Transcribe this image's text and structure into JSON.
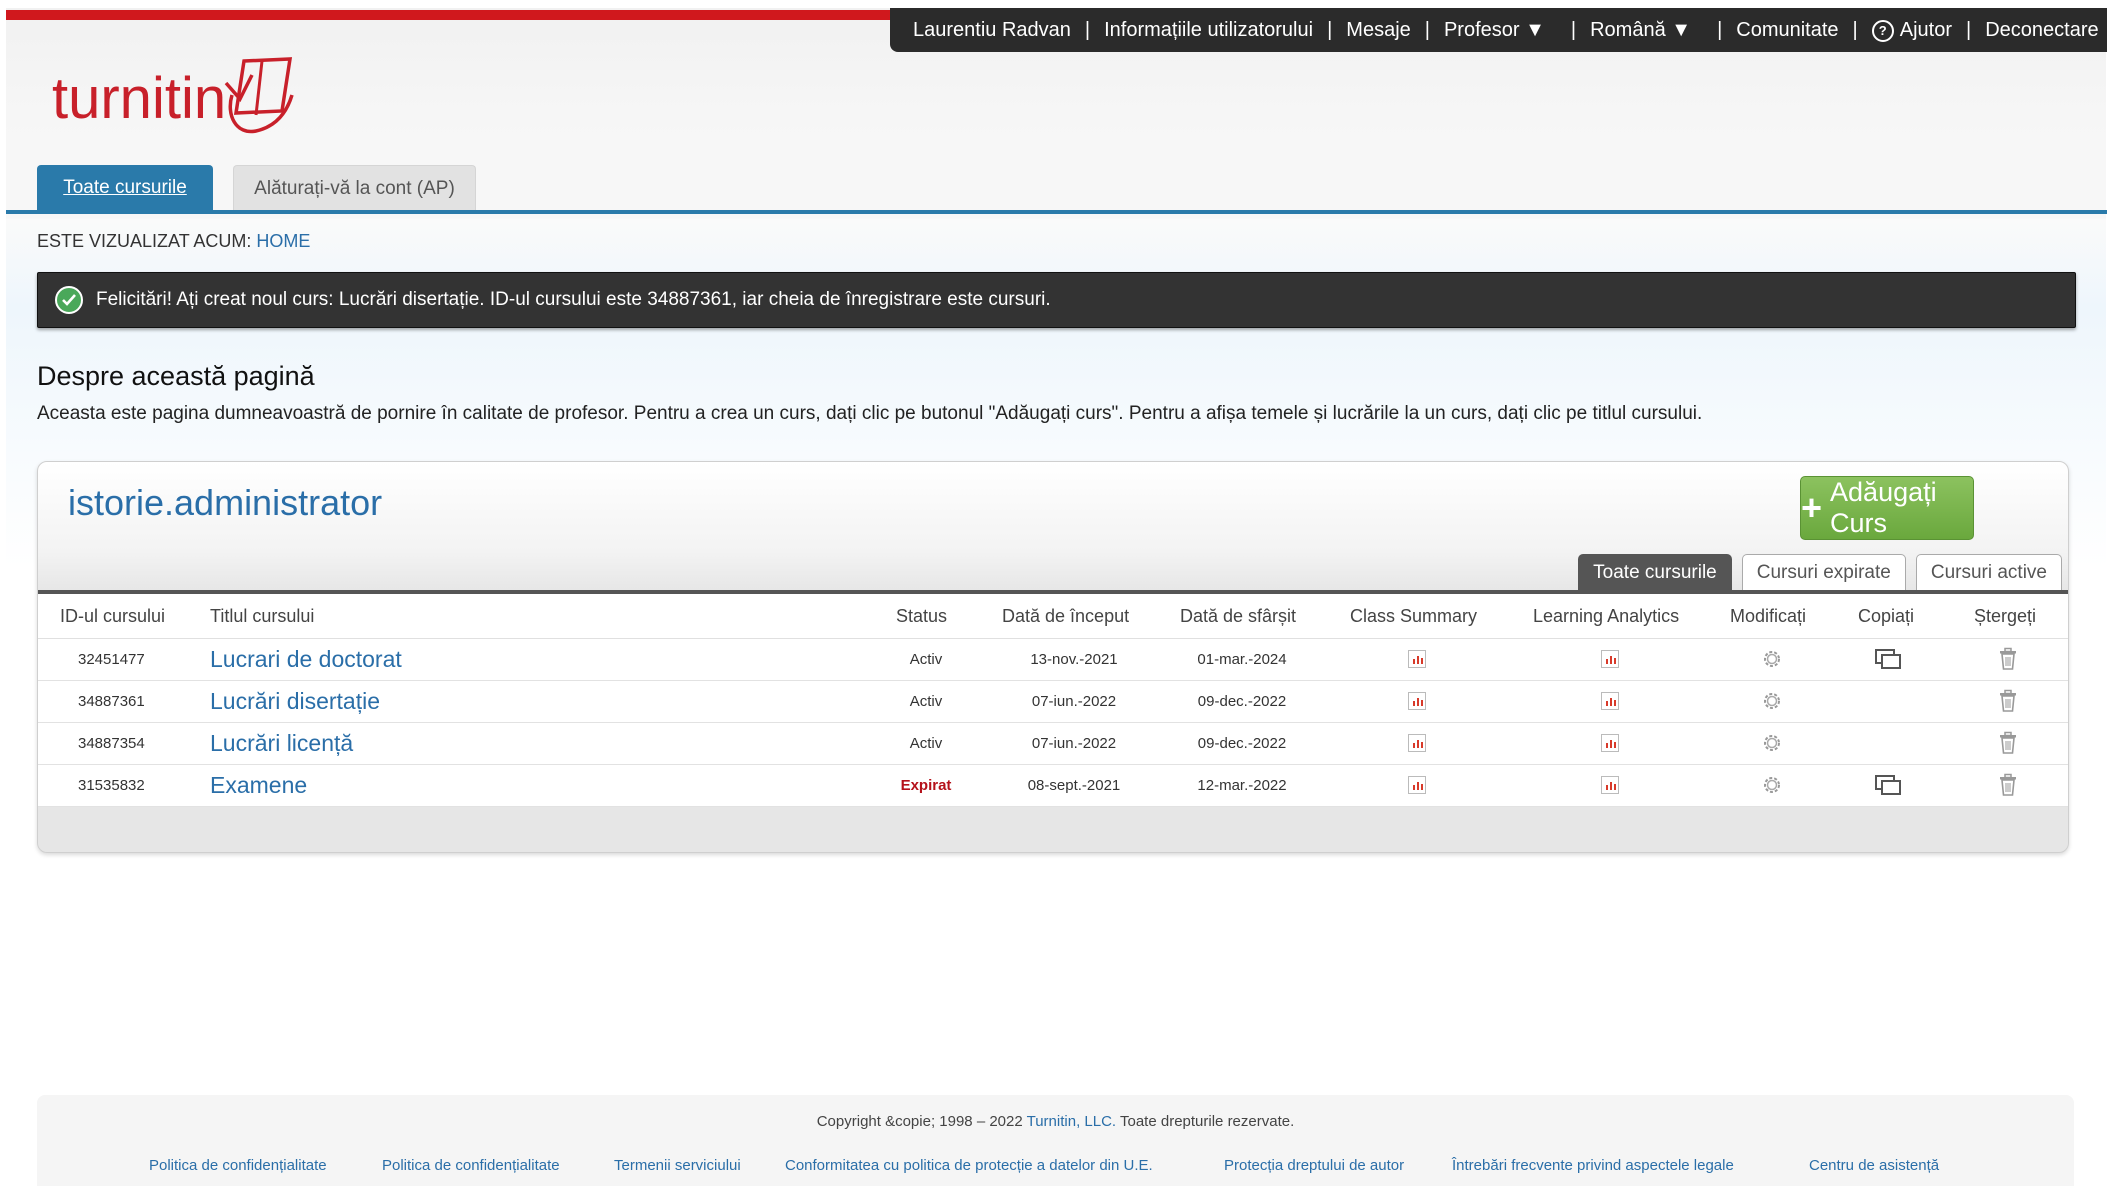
{
  "topnav": {
    "user": "Laurentiu Radvan",
    "user_info": "Informațiile utilizatorului",
    "messages": "Mesaje",
    "role": "Profesor ▼",
    "language": "Română ▼",
    "community": "Comunitate",
    "help_glyph": "?",
    "help": "Ajutor",
    "logout": "Deconectare",
    "separator": "|"
  },
  "logo": {
    "text": "turnitin",
    "color": "#c8202a"
  },
  "tabs": {
    "all_courses": "Toate cursurile",
    "join_account": "Alăturați-vă la cont (AP)"
  },
  "breadcrumb": {
    "label": "ESTE VIZUALIZAT ACUM:",
    "home": "HOME"
  },
  "alert": {
    "message": "Felicitări! Ați creat noul curs: Lucrări disertație. ID-ul cursului este 34887361, iar cheia de înregistrare este cursuri."
  },
  "about": {
    "title": "Despre această pagină",
    "text": "Aceasta este pagina dumneavoastră de pornire în calitate de profesor. Pentru a crea un curs, dați clic pe butonul \"Adăugați curs\". Pentru a afișa temele și lucrările la un curs, dați clic pe titlul cursului."
  },
  "panel": {
    "title": "istorie.administrator",
    "add_button_glyph": "+",
    "add_button": "Adăugați Curs",
    "filters": [
      "Toate cursurile",
      "Cursuri expirate",
      "Cursuri active"
    ],
    "columns": {
      "id": "ID-ul cursului",
      "title": "Titlul cursului",
      "status": "Status",
      "start": "Dată de început",
      "end": "Dată de sfârșit",
      "summary": "Class Summary",
      "analytics": "Learning Analytics",
      "edit": "Modificați",
      "copy": "Copiați",
      "delete": "Ștergeți"
    },
    "rows": [
      {
        "id": "32451477",
        "title": "Lucrari de doctorat",
        "status": "Activ",
        "start": "13-nov.-2021",
        "end": "01-mar.-2024",
        "copy": true
      },
      {
        "id": "34887361",
        "title": "Lucrări disertație",
        "status": "Activ",
        "start": "07-iun.-2022",
        "end": "09-dec.-2022",
        "copy": false
      },
      {
        "id": "34887354",
        "title": "Lucrări licență",
        "status": "Activ",
        "start": "07-iun.-2022",
        "end": "09-dec.-2022",
        "copy": false
      },
      {
        "id": "31535832",
        "title": "Examene",
        "status": "Expirat",
        "start": "08-sept.-2021",
        "end": "12-mar.-2022",
        "copy": true
      }
    ]
  },
  "footer": {
    "copyright_pre": "Copyright &copie; 1998 – 2022",
    "company": "Turnitin, LLC.",
    "copyright_post": "Toate drepturile rezervate.",
    "links": [
      "Politica de confidențialitate",
      "Politica de confidențialitate",
      "Termenii serviciului",
      "Conformitatea cu politica de protecție a datelor din U.E.",
      "Protecția dreptului de autor",
      "Întrebări frecvente privind aspectele legale",
      "Centru de asistență"
    ]
  },
  "colors": {
    "accent": "#2a7aaa",
    "brand_red": "#c8202a",
    "add_green": "#7ab54e",
    "expired": "#b5121b"
  }
}
